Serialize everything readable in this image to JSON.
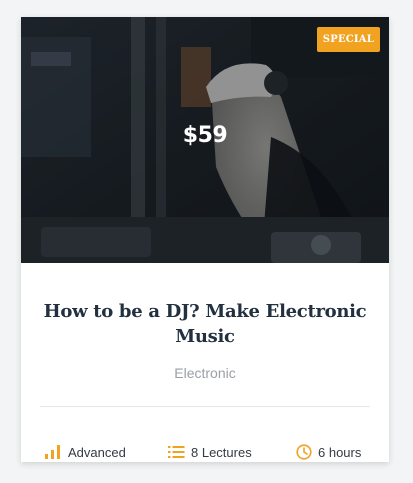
{
  "course": {
    "price": "$59",
    "badge": "SPECIAL",
    "title": "How to be a DJ? Make Electronic Music",
    "category": "Electronic",
    "level": "Advanced",
    "lectures": "8 Lectures",
    "duration": "6 hours"
  },
  "icons": {
    "level": "signal-bars-icon",
    "lectures": "list-icon",
    "duration": "clock-icon"
  },
  "colors": {
    "accent": "#f0a220",
    "title": "#22303f",
    "muted": "#9aa0a6"
  }
}
